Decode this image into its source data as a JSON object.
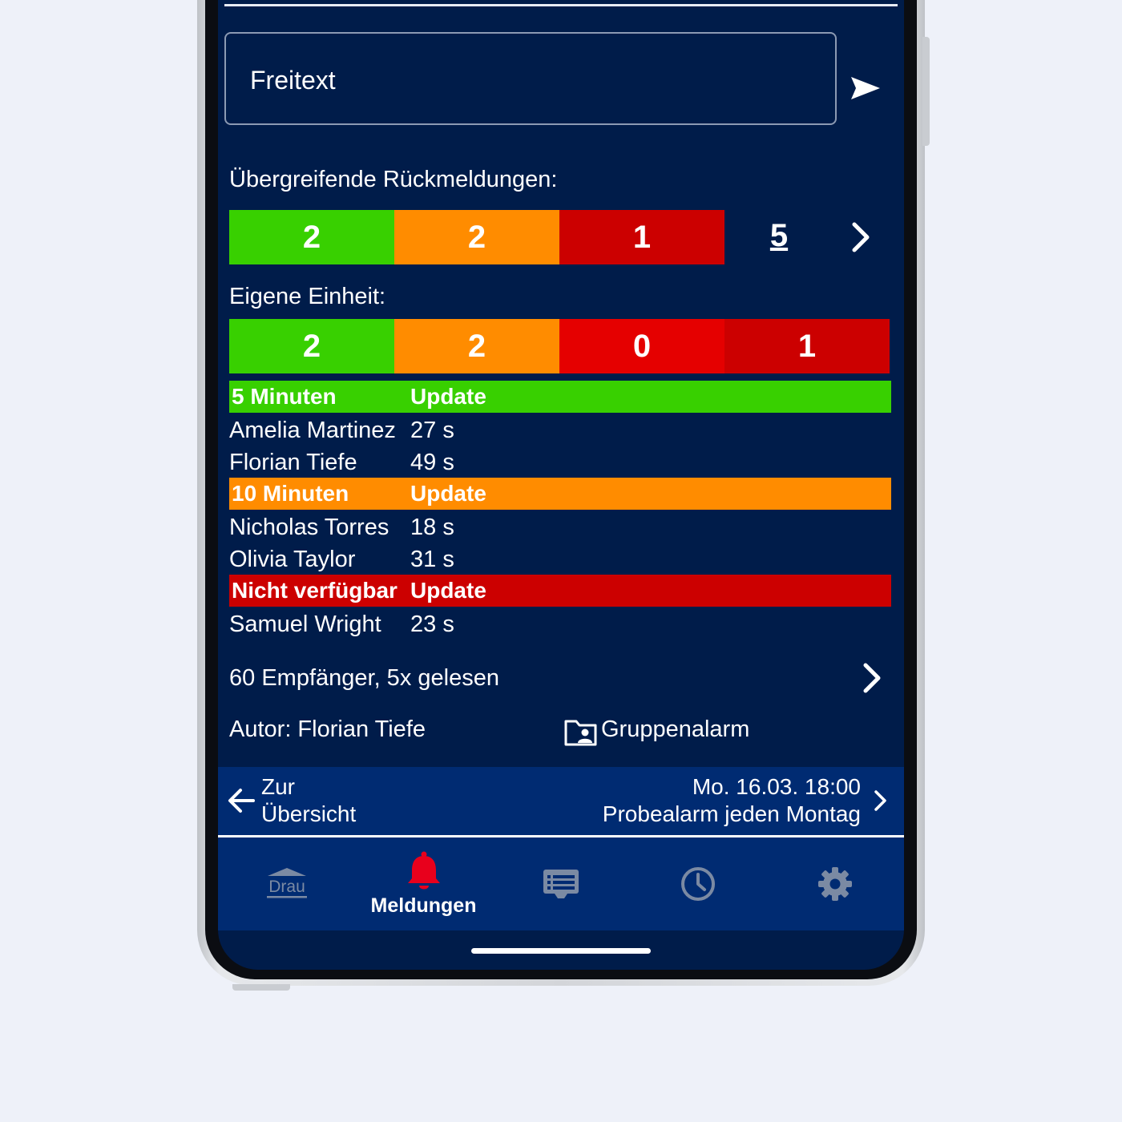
{
  "freitext": {
    "placeholder": "Freitext"
  },
  "overall": {
    "label": "Übergreifende Rückmeldungen:",
    "counts": [
      "2",
      "2",
      "1"
    ],
    "total": "5"
  },
  "own_unit": {
    "label": "Eigene Einheit:",
    "counts": [
      "2",
      "2",
      "0",
      "1"
    ]
  },
  "groups": [
    {
      "name": "5 Minuten",
      "update": "Update",
      "color": "#38d000",
      "people": [
        {
          "name": "Amelia Martinez",
          "time": "27 s"
        },
        {
          "name": "Florian Tiefe",
          "time": "49 s"
        }
      ]
    },
    {
      "name": "10 Minuten",
      "update": "Update",
      "color": "#ff8c00",
      "people": [
        {
          "name": "Nicholas Torres",
          "time": "18 s"
        },
        {
          "name": "Olivia Taylor",
          "time": "31 s"
        }
      ]
    },
    {
      "name": "Nicht verfügbar",
      "update": "Update",
      "color": "#cc0000",
      "people": [
        {
          "name": "Samuel Wright",
          "time": "23 s"
        }
      ]
    }
  ],
  "recipients": "60 Empfänger, 5x gelesen",
  "author": "Autor: Florian Tiefe",
  "category": "Gruppenalarm",
  "nav": {
    "back_line1": "Zur",
    "back_line2": "Übersicht",
    "next_date": "Mo. 16.03. 18:00",
    "next_title": "Probealarm jeden Montag"
  },
  "tabs": [
    {
      "icon": "drau-logo-icon",
      "label": "Drau"
    },
    {
      "icon": "bell-icon",
      "label": "Meldungen",
      "active": true,
      "active_color": "#e8001c"
    },
    {
      "icon": "message-list-icon",
      "label": ""
    },
    {
      "icon": "clock-icon",
      "label": ""
    },
    {
      "icon": "gear-icon",
      "label": ""
    }
  ],
  "colors": {
    "background": "#001c4a",
    "nav_background": "#002b72",
    "green": "#38d000",
    "orange": "#ff8c00",
    "red": "#e50000",
    "dark_red": "#cc0000",
    "inactive_icon": "#7b8aa3"
  }
}
